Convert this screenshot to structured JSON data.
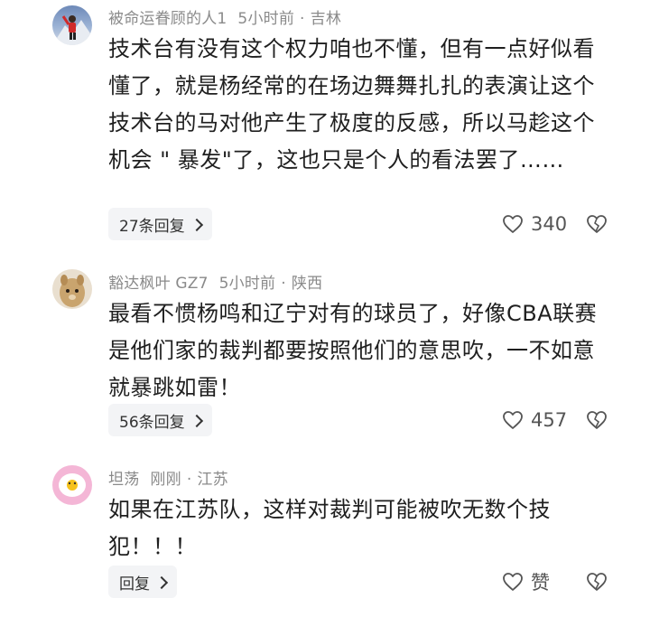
{
  "comments": [
    {
      "username": "被命运眷顾的人1",
      "time": "5小时前",
      "dot": "·",
      "location": "吉林",
      "text": "技术台有没有这个权力咱也不懂，但有一点好似看懂了，就是杨经常的在场边舞舞扎扎的表演让这个技术台的马对他产生了极度的反感，所以马趁这个机会 \" 暴发\"了，这也只是个人的看法罢了……",
      "reply_label": "27条回复",
      "likes": "340",
      "avatar_icon": "mountain-climber-avatar"
    },
    {
      "username": "豁达枫叶 GZ7",
      "time": "5小时前",
      "dot": "·",
      "location": "陕西",
      "text": "最看不惯杨鸣和辽宁对有的球员了，好像CBA联赛是他们家的裁判都要按照他们的意思吹，一不如意就暴跳如雷！",
      "reply_label": "56条回复",
      "likes": "457",
      "avatar_icon": "plush-toy-avatar"
    },
    {
      "username": "坦荡",
      "time": "刚刚",
      "dot": "·",
      "location": "江苏",
      "text": "如果在江苏队，这样对裁判可能被吹无数个技犯！！！",
      "reply_label": "回复",
      "likes": "赞",
      "avatar_icon": "fried-egg-avatar"
    }
  ]
}
